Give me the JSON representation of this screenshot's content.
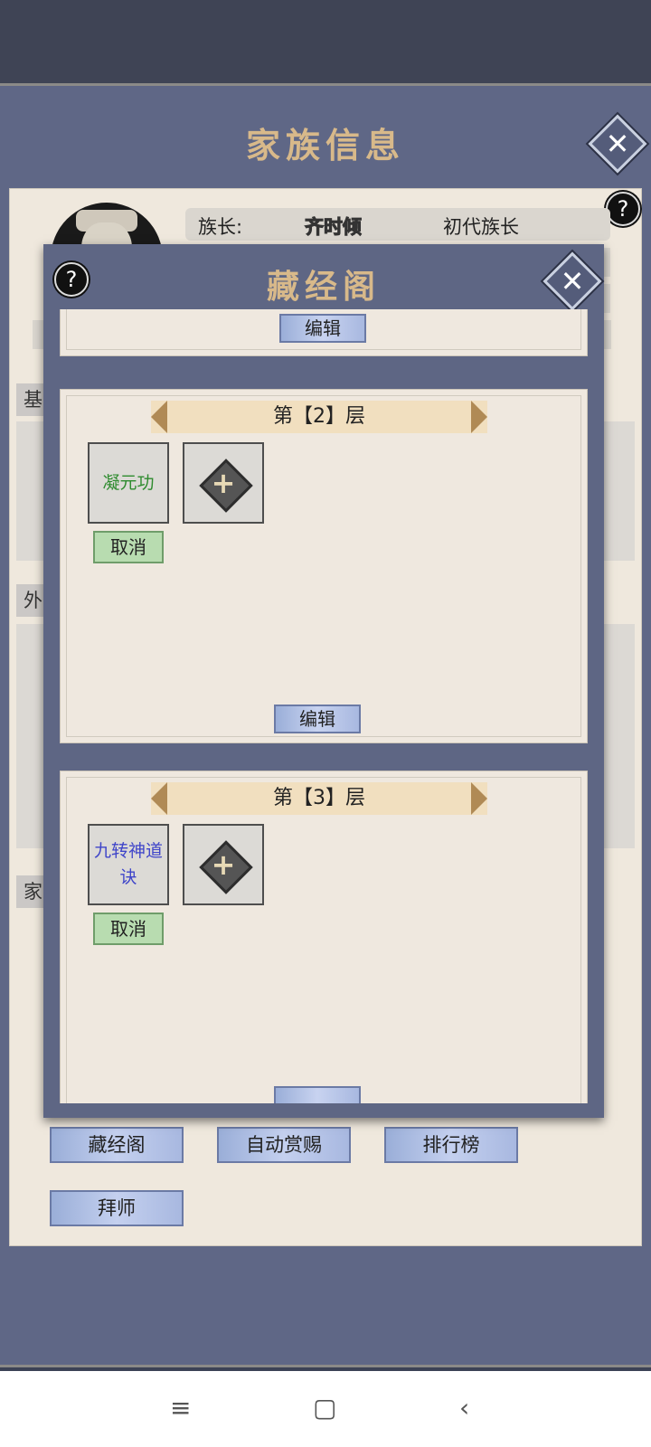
{
  "outer": {
    "title": "家族信息",
    "close_icon": "✕",
    "help_icon": "?",
    "leader_label": "族长:",
    "leader_name": "齐时倾",
    "leader_title": "初代族长",
    "section_tabs": [
      "基",
      "外",
      "家"
    ],
    "buttons": [
      "藏经阁",
      "自动赏赐",
      "排行榜",
      "拜师"
    ]
  },
  "modal": {
    "title": "藏经阁",
    "help_icon": "?",
    "close_icon": "✕",
    "edit_label": "编辑",
    "floors": [
      {
        "header": "第【2】层",
        "skill": "凝元功",
        "skill_color": "#2e8b2e",
        "cancel": "取消",
        "edit": "编辑"
      },
      {
        "header": "第【3】层",
        "skill": "九转神道诀",
        "skill_color": "#3f45c9",
        "cancel": "取消"
      }
    ]
  },
  "navbar": {
    "menu_icon": "≡",
    "home_icon": "▢",
    "back_icon": "‹"
  }
}
